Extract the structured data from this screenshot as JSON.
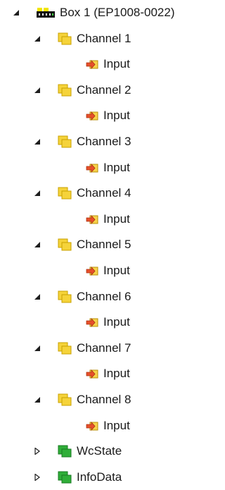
{
  "tree": {
    "root": {
      "label": "Box 1 (EP1008-0022)",
      "expanded": true,
      "icon": "box-terminal-icon"
    },
    "channels": [
      {
        "label": "Channel 1",
        "expanded": true,
        "icon": "folder-yellow-icon",
        "child": {
          "label": "Input",
          "icon": "input-arrow-icon"
        }
      },
      {
        "label": "Channel 2",
        "expanded": true,
        "icon": "folder-yellow-icon",
        "child": {
          "label": "Input",
          "icon": "input-arrow-icon"
        }
      },
      {
        "label": "Channel 3",
        "expanded": true,
        "icon": "folder-yellow-icon",
        "child": {
          "label": "Input",
          "icon": "input-arrow-icon"
        }
      },
      {
        "label": "Channel 4",
        "expanded": true,
        "icon": "folder-yellow-icon",
        "child": {
          "label": "Input",
          "icon": "input-arrow-icon"
        }
      },
      {
        "label": "Channel 5",
        "expanded": true,
        "icon": "folder-yellow-icon",
        "child": {
          "label": "Input",
          "icon": "input-arrow-icon"
        }
      },
      {
        "label": "Channel 6",
        "expanded": true,
        "icon": "folder-yellow-icon",
        "child": {
          "label": "Input",
          "icon": "input-arrow-icon"
        }
      },
      {
        "label": "Channel 7",
        "expanded": true,
        "icon": "folder-yellow-icon",
        "child": {
          "label": "Input",
          "icon": "input-arrow-icon"
        }
      },
      {
        "label": "Channel 8",
        "expanded": true,
        "icon": "folder-yellow-icon",
        "child": {
          "label": "Input",
          "icon": "input-arrow-icon"
        }
      }
    ],
    "extras": [
      {
        "label": "WcState",
        "expanded": false,
        "icon": "folder-green-icon"
      },
      {
        "label": "InfoData",
        "expanded": false,
        "icon": "folder-green-icon"
      }
    ]
  },
  "colors": {
    "folder_yellow": "#f5d33a",
    "folder_yellow_dark": "#c9a200",
    "folder_green": "#2fae38",
    "folder_green_dark": "#1a7a22",
    "input_arrow": "#e8502a",
    "input_bg": "#f7d24a"
  }
}
